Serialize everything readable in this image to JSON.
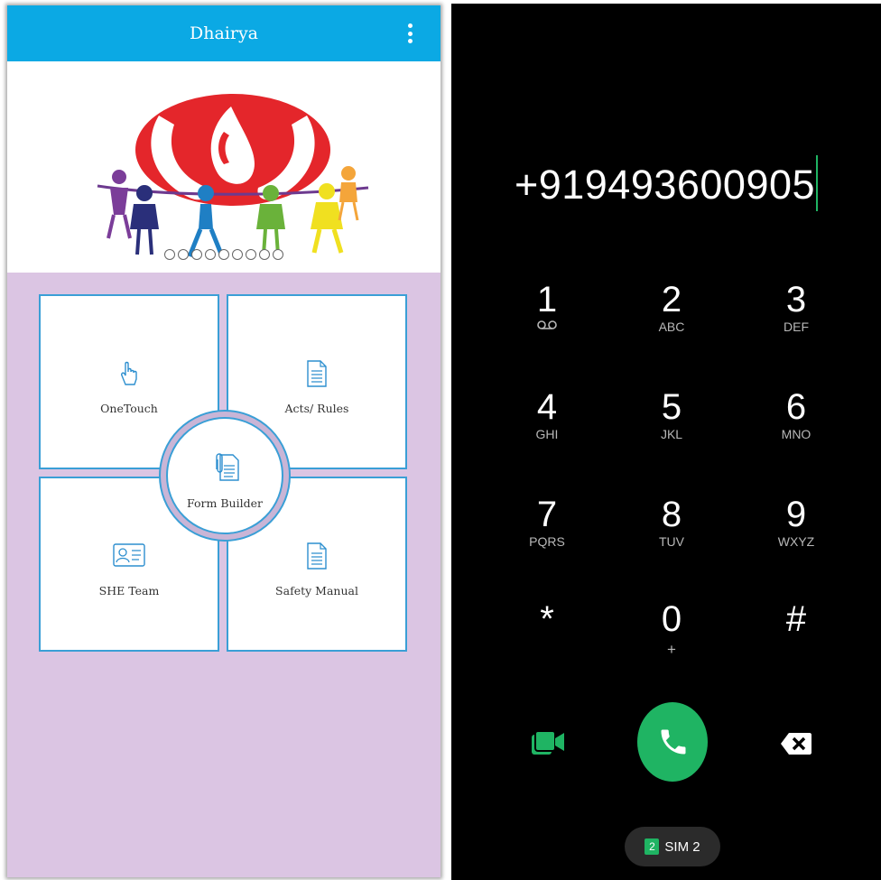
{
  "left_app": {
    "title": "Dhairya",
    "carousel_dot_count": 9,
    "tiles": [
      {
        "label": "OneTouch",
        "icon": "tap-hand-icon"
      },
      {
        "label": "Acts/ Rules",
        "icon": "document-icon"
      },
      {
        "label": "SHE Team",
        "icon": "id-card-icon"
      },
      {
        "label": "Safety Manual",
        "icon": "document-icon"
      }
    ],
    "center": {
      "label": "Form Builder",
      "icon": "form-clip-icon"
    },
    "colors": {
      "appbar": "#0ba9e4",
      "background": "#dbc5e3",
      "tile_border": "#3a9fd6"
    }
  },
  "dialer": {
    "number": "+919493600905",
    "keys": [
      {
        "digit": "1",
        "letters": ""
      },
      {
        "digit": "2",
        "letters": "ABC"
      },
      {
        "digit": "3",
        "letters": "DEF"
      },
      {
        "digit": "4",
        "letters": "GHI"
      },
      {
        "digit": "5",
        "letters": "JKL"
      },
      {
        "digit": "6",
        "letters": "MNO"
      },
      {
        "digit": "7",
        "letters": "PQRS"
      },
      {
        "digit": "8",
        "letters": "TUV"
      },
      {
        "digit": "9",
        "letters": "WXYZ"
      },
      {
        "digit": "*",
        "letters": ""
      },
      {
        "digit": "0",
        "letters": "+"
      },
      {
        "digit": "#",
        "letters": ""
      }
    ],
    "sim": {
      "number": "2",
      "label": "SIM 2"
    },
    "icons": {
      "key_1_sub": "voicemail-icon",
      "video_call": "video-call-icon",
      "call": "phone-icon",
      "delete": "backspace-icon"
    },
    "colors": {
      "accent": "#1fb463",
      "background": "#000000"
    }
  }
}
